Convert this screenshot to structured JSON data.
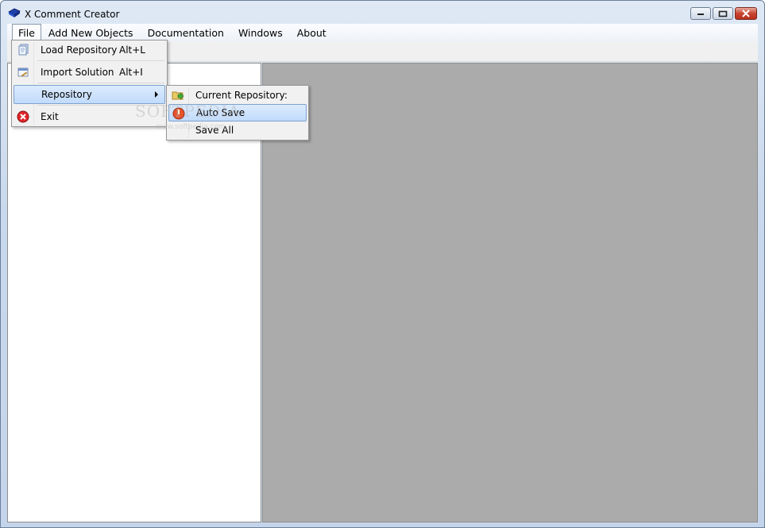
{
  "window": {
    "title": "X Comment Creator",
    "controls": {
      "minimize": "minimize-icon",
      "maximize": "maximize-icon",
      "close": "close-icon"
    }
  },
  "menubar": {
    "items": [
      {
        "label": "File"
      },
      {
        "label": "Add New Objects"
      },
      {
        "label": "Documentation"
      },
      {
        "label": "Windows"
      },
      {
        "label": "About"
      }
    ]
  },
  "file_menu": {
    "items": [
      {
        "label": "Load Repository",
        "accel": "Alt+L",
        "icon": "load-repository-icon"
      },
      {
        "label": "Import Solution",
        "accel": "Alt+I",
        "icon": "import-solution-icon"
      },
      {
        "label": "Repository",
        "accel": "",
        "icon": ""
      },
      {
        "label": "Exit",
        "accel": "",
        "icon": "exit-icon"
      }
    ]
  },
  "repository_submenu": {
    "items": [
      {
        "label": "Current Repository:",
        "icon": "current-repository-icon"
      },
      {
        "label": "Auto Save",
        "icon": "auto-save-icon"
      },
      {
        "label": "Save All",
        "icon": ""
      }
    ]
  },
  "watermark": {
    "text": "SOFTPEDIA",
    "url": "www.softpedia.com"
  },
  "colors": {
    "highlight": "#c1dbfc",
    "workspace": "#ababab",
    "close_button": "#c94430"
  }
}
